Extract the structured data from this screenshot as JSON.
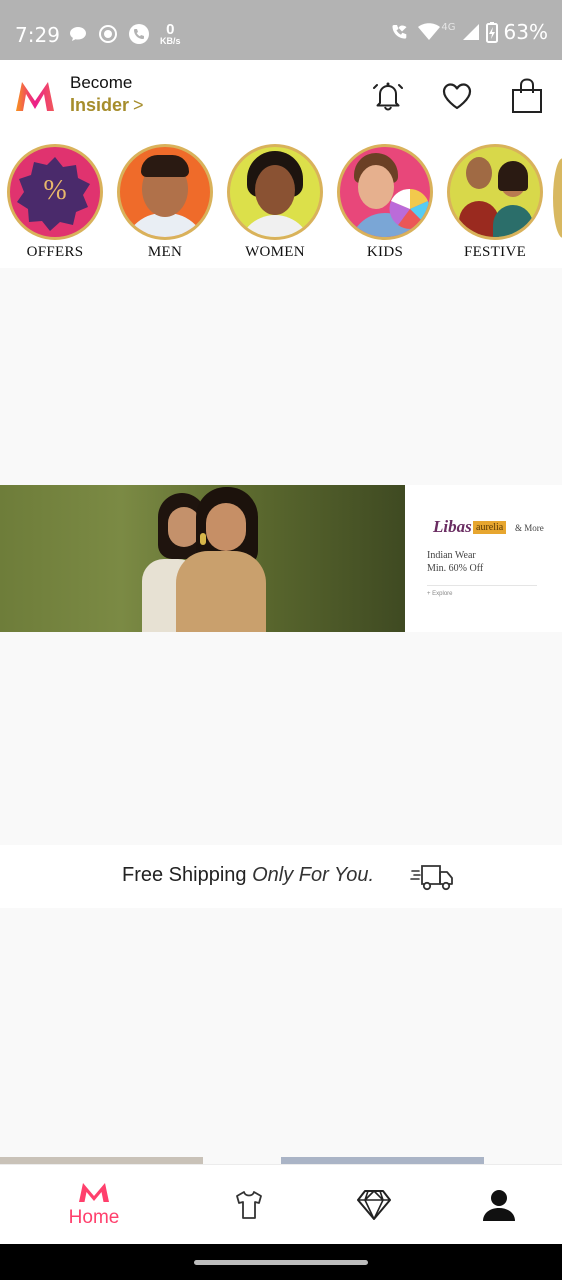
{
  "status_bar": {
    "time": "7:29",
    "speed_value": "0",
    "speed_unit": "KB/s",
    "network": "4G",
    "battery": "63%"
  },
  "header": {
    "insider_line1": "Become",
    "insider_line2": "Insider",
    "insider_chevron": ">",
    "brand_color": "#ff3f6c",
    "accent_gold": "#a68d2c"
  },
  "categories": [
    {
      "label": "OFFERS",
      "bg": "#e0336f"
    },
    {
      "label": "MEN",
      "bg": "#ef6b2a"
    },
    {
      "label": "WOMEN",
      "bg": "#dce04a"
    },
    {
      "label": "KIDS",
      "bg": "#e8477a"
    },
    {
      "label": "FESTIVE",
      "bg": "#d8d84a"
    }
  ],
  "offers_symbol": "%",
  "banner": {
    "brand1": "Libas",
    "brand2": "aurelia",
    "brand_more": "& More",
    "offer_line1": "Indian Wear",
    "offer_line2": "Min. 60% Off",
    "cta": "+ Explore"
  },
  "shipping": {
    "text_regular": "Free Shipping",
    "text_italic": "Only For You."
  },
  "bottom_nav": {
    "home_label": "Home",
    "active_color": "#ff3f6c"
  }
}
